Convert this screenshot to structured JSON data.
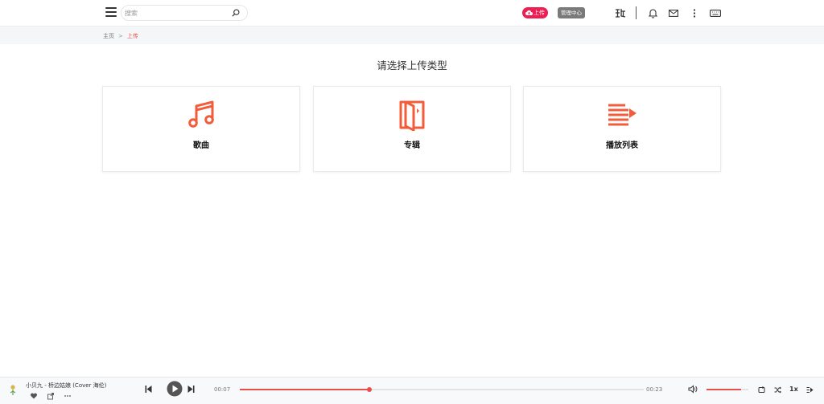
{
  "header": {
    "search_placeholder": "搜索",
    "upload_label": "上传",
    "admin_label": "管理中心",
    "colors": {
      "upload_bg": "#ee1d52",
      "admin_bg": "#7a7a7a"
    },
    "icons": [
      "menu-icon",
      "search-icon",
      "cloud-upload-icon",
      "logo-icon",
      "bell-icon",
      "mail-icon",
      "more-vertical-icon",
      "keyboard-icon"
    ]
  },
  "breadcrumb": {
    "home": "主页",
    "separator": ">",
    "current": "上传"
  },
  "main": {
    "title": "请选择上传类型",
    "accent_color": "#f25c3b",
    "cards": [
      {
        "label": "歌曲",
        "icon": "music-note-icon"
      },
      {
        "label": "专辑",
        "icon": "album-folder-icon"
      },
      {
        "label": "播放列表",
        "icon": "playlist-icon"
      }
    ]
  },
  "player": {
    "song_title": "小贝九 - 桥边姑娘 (Cover 海伦)",
    "current_time": "00:07",
    "total_time": "00:23",
    "progress_fraction": 0.32,
    "volume_fraction": 0.82,
    "speed_label": "1x",
    "accent_color": "#e94f4a",
    "icons": [
      "heart-icon",
      "share-icon",
      "more-horizontal-icon",
      "previous-icon",
      "play-icon",
      "next-icon",
      "volume-icon",
      "repeat-icon",
      "shuffle-icon",
      "queue-icon"
    ]
  }
}
